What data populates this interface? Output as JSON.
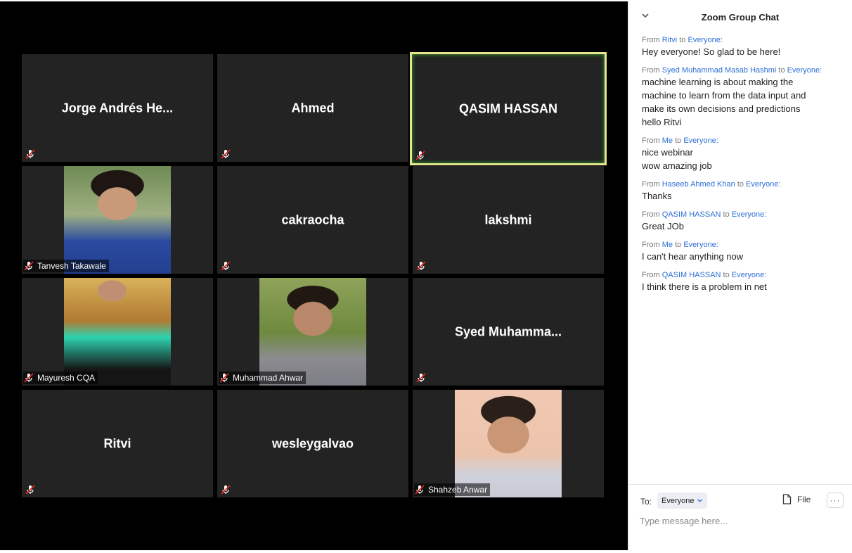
{
  "tiles": [
    {
      "name": "Jorge Andrés He...",
      "type": "name"
    },
    {
      "name": "Ahmed",
      "type": "name"
    },
    {
      "name": "QASIM HASSAN",
      "type": "name",
      "active": true
    },
    {
      "name": "Tanvesh Takawale",
      "type": "photo"
    },
    {
      "name": "cakraocha",
      "type": "name"
    },
    {
      "name": "lakshmi",
      "type": "name"
    },
    {
      "name": "Mayuresh CQA",
      "type": "photo"
    },
    {
      "name": "Muhammad Ahwar",
      "type": "photo"
    },
    {
      "name": "Syed  Muhamma...",
      "type": "name"
    },
    {
      "name": "Ritvi",
      "type": "name"
    },
    {
      "name": "wesleygalvao",
      "type": "name"
    },
    {
      "name": "Shahzeb Anwar",
      "type": "photo"
    }
  ],
  "chat": {
    "title": "Zoom Group Chat",
    "from_word": "From",
    "to_word": "to",
    "messages": [
      {
        "from": "Ritvi",
        "to": "Everyone:",
        "lines": [
          "Hey everyone! So glad to be here!"
        ]
      },
      {
        "from": "Syed Muhammad Masab Hashmi",
        "to": "Everyone:",
        "lines": [
          "machine learning is about making the",
          "machine to learn from the data input and",
          "make its own decisions and predictions",
          "hello Ritvi"
        ]
      },
      {
        "from": "Me",
        "to": "Everyone:",
        "lines": [
          "nice webinar",
          "wow amazing job"
        ]
      },
      {
        "from": "Haseeb Ahmed Khan",
        "to": "Everyone:",
        "lines": [
          "Thanks"
        ]
      },
      {
        "from": "QASIM HASSAN",
        "to": "Everyone:",
        "lines": [
          "Great JOb"
        ]
      },
      {
        "from": "Me",
        "to": "Everyone:",
        "lines": [
          "I can't hear anything now"
        ]
      },
      {
        "from": "QASIM HASSAN",
        "to": "Everyone:",
        "lines": [
          "I think there is a problem in net"
        ]
      }
    ],
    "to_label": "To:",
    "recipient": "Everyone",
    "file_label": "File",
    "input_placeholder": "Type message here...",
    "colors": {
      "link": "#2d6fd6",
      "active_border": "#e6e690"
    }
  }
}
